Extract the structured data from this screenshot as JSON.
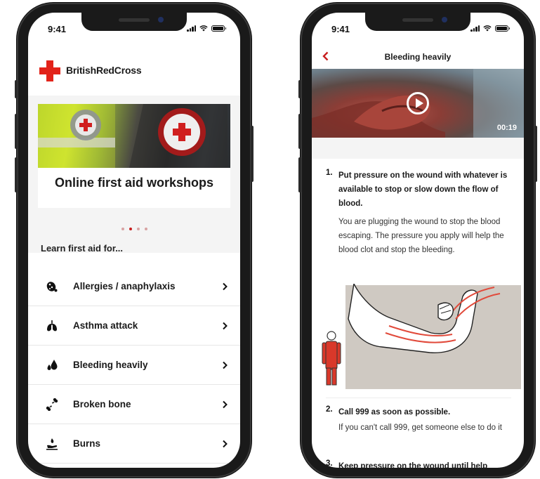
{
  "status": {
    "time_left": "9:41",
    "time_right": "9:41"
  },
  "left": {
    "brand": "BritishRedCross",
    "banner_title": "Online first aid workshops",
    "learn_heading": "Learn first aid for...",
    "items": [
      {
        "label": "Allergies / anaphylaxis",
        "icon": "allergy-icon"
      },
      {
        "label": "Asthma attack",
        "icon": "lungs-icon"
      },
      {
        "label": "Bleeding heavily",
        "icon": "blood-drops-icon"
      },
      {
        "label": "Broken bone",
        "icon": "broken-bone-icon"
      },
      {
        "label": "Burns",
        "icon": "burn-hand-icon"
      }
    ],
    "carousel": {
      "count": 4,
      "active": 1
    }
  },
  "right": {
    "title": "Bleeding heavily",
    "video_duration": "00:19",
    "steps": [
      {
        "num": "1.",
        "heading": "Put pressure on the wound with whatever is available to stop or slow down the flow of blood.",
        "text": "You are plugging the wound to stop the blood escaping. The pressure you apply will help the blood clot and stop the bleeding."
      },
      {
        "num": "2.",
        "heading": "Call 999 as soon as possible.",
        "text": "If you can't call 999, get someone else to do it"
      },
      {
        "num": "3.",
        "heading": "Keep pressure on the wound until help"
      }
    ]
  },
  "colors": {
    "brand_red": "#e2231a",
    "accent_red": "#c81e1e",
    "section_grey": "#f4f4f4"
  }
}
